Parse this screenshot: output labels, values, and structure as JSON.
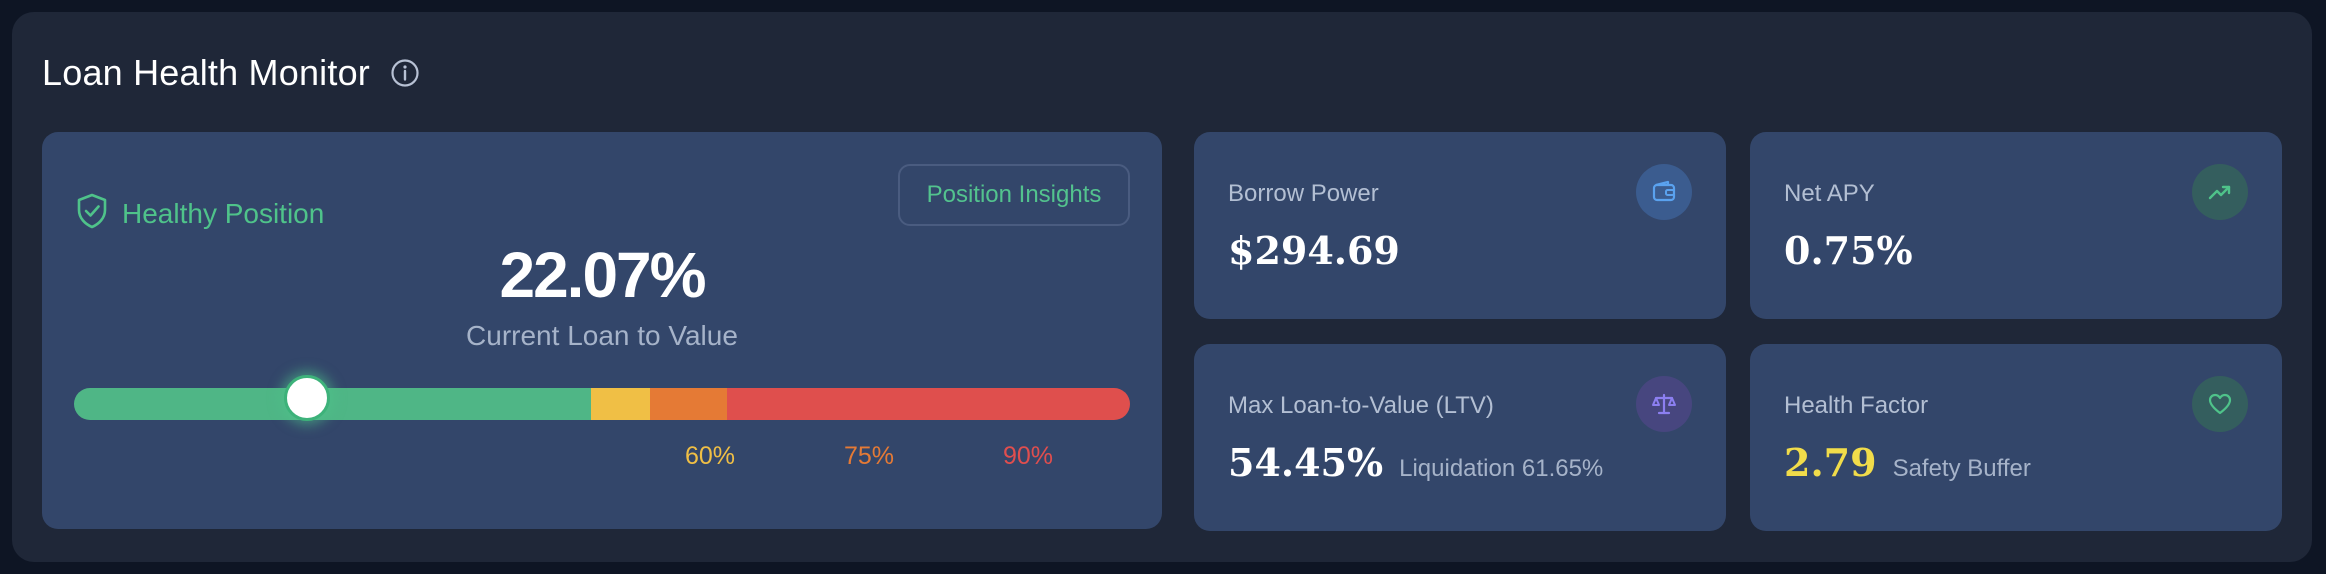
{
  "header": {
    "title": "Loan Health Monitor",
    "info_icon": "info-circle-icon"
  },
  "position": {
    "status": "Healthy Position",
    "status_icon": "shield-check-icon",
    "insights_button": "Position Insights",
    "ltv_value": "22.07%",
    "ltv_label": "Current Loan to Value",
    "ltv_fraction": 0.2207,
    "thresholds": [
      {
        "label": "60%",
        "color": "#f0bf45"
      },
      {
        "label": "75%",
        "color": "#e57a35"
      },
      {
        "label": "90%",
        "color": "#e04e4e"
      }
    ]
  },
  "borrow_power": {
    "label": "Borrow Power",
    "value": "$294.69",
    "icon": "wallet-icon"
  },
  "net_apy": {
    "label": "Net APY",
    "value": "0.75%",
    "icon": "trending-up-icon"
  },
  "max_ltv": {
    "label": "Max Loan-to-Value (LTV)",
    "value": "54.45%",
    "sub": "Liquidation 61.65%",
    "icon": "scale-icon"
  },
  "health_factor": {
    "label": "Health Factor",
    "value": "2.79",
    "sub": "Safety Buffer",
    "icon": "heart-icon"
  },
  "colors": {
    "healthy": "#4fc38a",
    "warning": "#f0bf45",
    "caution": "#e57a35",
    "danger": "#e04e4e",
    "health_value": "#f1dc4a"
  }
}
